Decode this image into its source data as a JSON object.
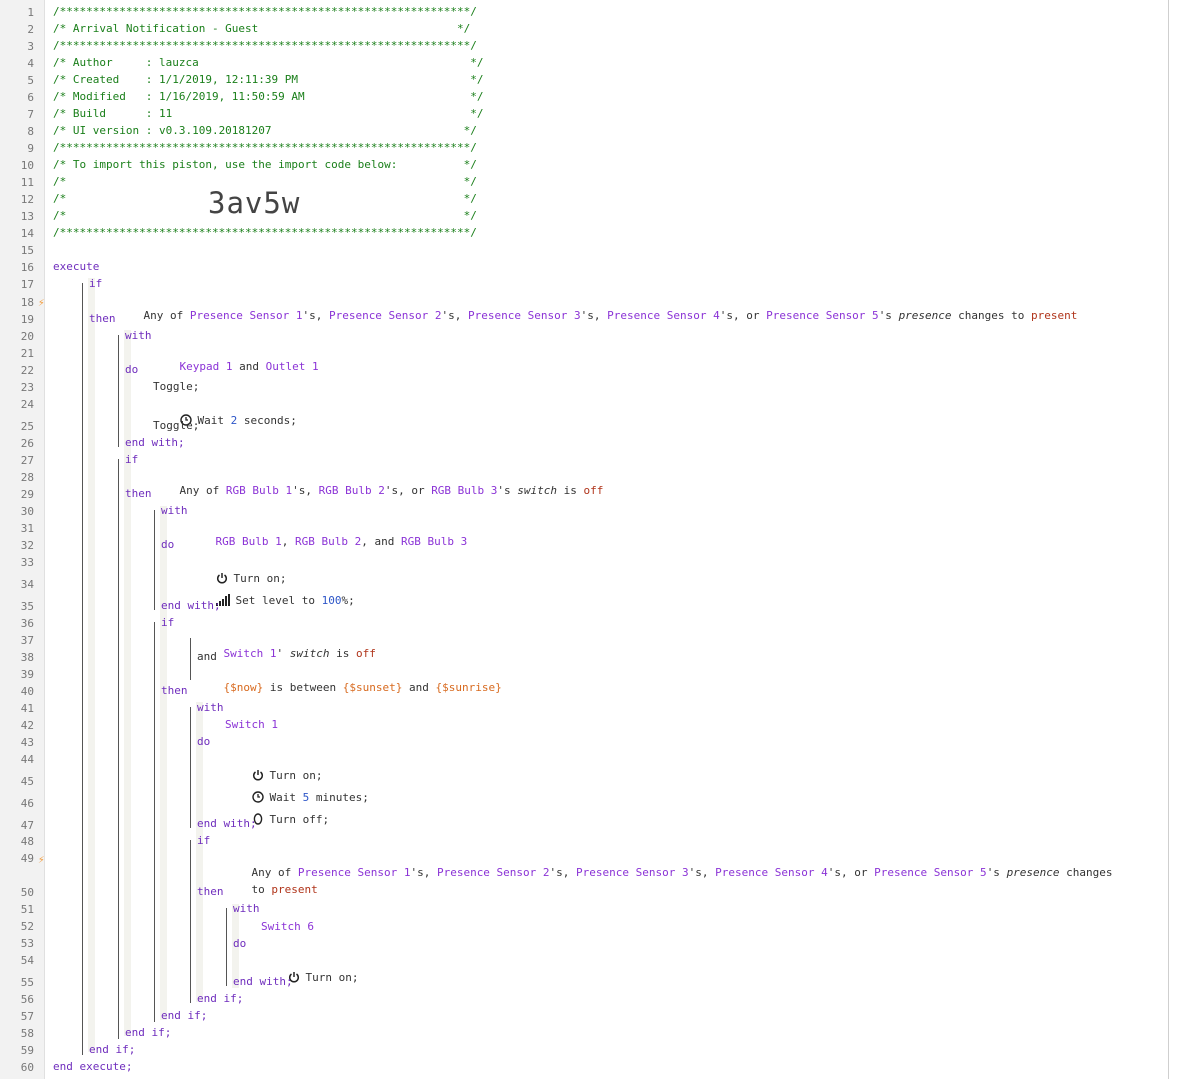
{
  "line_numbers": [
    "1",
    "2",
    "3",
    "4",
    "5",
    "6",
    "7",
    "8",
    "9",
    "10",
    "11",
    "12",
    "13",
    "14",
    "15",
    "16",
    "17",
    "18",
    "19",
    "20",
    "21",
    "22",
    "23",
    "24",
    "25",
    "26",
    "27",
    "28",
    "29",
    "30",
    "31",
    "32",
    "33",
    "34",
    "35",
    "36",
    "37",
    "38",
    "39",
    "40",
    "41",
    "42",
    "43",
    "44",
    "45",
    "46",
    "47",
    "48",
    "49",
    "50",
    "51",
    "52",
    "53",
    "54",
    "55",
    "56",
    "57",
    "58",
    "59",
    "60"
  ],
  "header": {
    "border": "/**************************************************************/",
    "title": "/* Arrival Notification - Guest                              */",
    "author": "/* Author     : lauzca                                         */",
    "created": "/* Created    : 1/1/2019, 12:11:39 PM                          */",
    "modified": "/* Modified   : 1/16/2019, 11:50:59 AM                         */",
    "build": "/* Build      : 11                                             */",
    "ui_version": "/* UI version : v0.3.109.20181207                             */",
    "import_note": "/* To import this piston, use the import code below:          */",
    "blank": "/*                                                            */",
    "import_code": "3av5w"
  },
  "kw": {
    "execute": "execute",
    "if": "if",
    "then": "then",
    "with": "with",
    "do": "do",
    "end_with": "end with;",
    "end_if": "end if;",
    "end_execute": "end execute;",
    "and": "and"
  },
  "cond1": {
    "any_of": "Any of ",
    "d1": "Presence Sensor 1",
    "s1": "'s, ",
    "d2": "Presence Sensor 2",
    "s2": "'s, ",
    "d3": "Presence Sensor 3",
    "s3": "'s, ",
    "d4": "Presence Sensor 4",
    "s4": "'s, or ",
    "d5": "Presence Sensor 5",
    "s5": "'s ",
    "attr": "presence",
    "op": " changes to ",
    "value": "present"
  },
  "with1": {
    "d1": "Keypad 1",
    "and": " and ",
    "d2": "Outlet 1",
    "toggle": "Toggle;",
    "wait_pre": "Wait ",
    "wait_num": "2",
    "wait_post": " seconds;"
  },
  "cond2": {
    "any_of": "Any of ",
    "d1": "RGB Bulb 1",
    "s1": "'s, ",
    "d2": "RGB Bulb 2",
    "s2": "'s, or ",
    "d3": "RGB Bulb 3",
    "s3": "'s ",
    "attr": "switch",
    "op": " is ",
    "value": "off"
  },
  "with2": {
    "d1": "RGB Bulb 1",
    "c1": ", ",
    "d2": "RGB Bulb 2",
    "c2": ", and ",
    "d3": "RGB Bulb 3",
    "turn_on": "Turn on;",
    "level_pre": "Set level to ",
    "level_num": "100",
    "level_post": "%;"
  },
  "cond3": {
    "d1": "Switch 1",
    "q": "' ",
    "attr": "switch",
    "op": " is ",
    "value": "off",
    "now": "{$now}",
    "between": " is between ",
    "sunset": "{$sunset}",
    "and": " and ",
    "sunrise": "{$sunrise}"
  },
  "with3": {
    "d1": "Switch 1",
    "turn_on": "Turn on;",
    "wait_pre": "Wait ",
    "wait_num": "5",
    "wait_post": " minutes;",
    "turn_off": "Turn off;"
  },
  "cond4": {
    "any_of": "Any of ",
    "d1": "Presence Sensor 1",
    "s1": "'s, ",
    "d2": "Presence Sensor 2",
    "s2": "'s, ",
    "d3": "Presence Sensor 3",
    "s3": "'s, ",
    "d4": "Presence Sensor 4",
    "s4": "'s, or ",
    "d5": "Presence Sensor 5",
    "s5": "'s ",
    "attr": "presence",
    "op": " changes",
    "to": "to ",
    "value": "present"
  },
  "with4": {
    "d1": "Switch 6",
    "turn_on": "Turn on;"
  },
  "colors": {
    "comment": "#1a7f1a",
    "keyword": "#6f2dbd",
    "device": "#8b33d6",
    "value": "#b0341a",
    "number": "#2d56c8",
    "expression": "#d86a1f",
    "bolt": "#f39c3c"
  }
}
